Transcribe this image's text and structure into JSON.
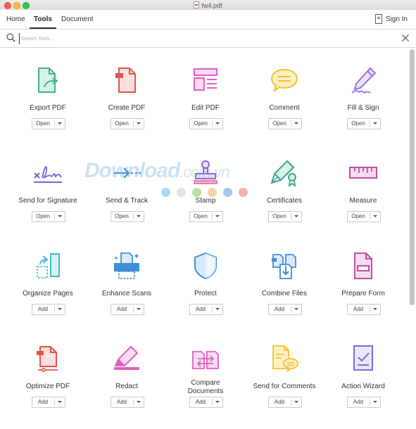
{
  "window": {
    "title": "fw4.pdf"
  },
  "nav": {
    "tabs": [
      {
        "label": "Home"
      },
      {
        "label": "Tools"
      },
      {
        "label": "Document"
      }
    ],
    "signin_label": "Sign In"
  },
  "search": {
    "placeholder": "Search Tools..."
  },
  "watermark": {
    "text": "Download",
    "suffix": ".com.vn",
    "dot_colors": [
      "#a9d8f0",
      "#e3e3e3",
      "#b9dfa4",
      "#f6d4a8",
      "#a3c7ec",
      "#f3b2b2"
    ]
  },
  "tools": [
    {
      "name": "Export PDF",
      "button": "Open",
      "icon": "export-pdf-icon",
      "color": "#3fb48f"
    },
    {
      "name": "Create PDF",
      "button": "Open",
      "icon": "create-pdf-icon",
      "color": "#e2534a"
    },
    {
      "name": "Edit PDF",
      "button": "Open",
      "icon": "edit-pdf-icon",
      "color": "#e060c6"
    },
    {
      "name": "Comment",
      "button": "Open",
      "icon": "comment-icon",
      "color": "#f2c12e"
    },
    {
      "name": "Fill & Sign",
      "button": "Open",
      "icon": "fill-sign-icon",
      "color": "#9b6ee8"
    },
    {
      "name": "Send for Signature",
      "button": "Open",
      "icon": "send-signature-icon",
      "color": "#6f64d8"
    },
    {
      "name": "Send & Track",
      "button": "Open",
      "icon": "send-track-icon",
      "color": "#3a8fd9"
    },
    {
      "name": "Stamp",
      "button": "Open",
      "icon": "stamp-icon",
      "color": "#8b6ad8"
    },
    {
      "name": "Certificates",
      "button": "Open",
      "icon": "certificates-icon",
      "color": "#3fa58a"
    },
    {
      "name": "Measure",
      "button": "Open",
      "icon": "measure-icon",
      "color": "#c14ea3"
    },
    {
      "name": "Organize Pages",
      "button": "Add",
      "icon": "organize-pages-icon",
      "color": "#45b9d6"
    },
    {
      "name": "Enhance Scans",
      "button": "Add",
      "icon": "enhance-scans-icon",
      "color": "#3e8fd5"
    },
    {
      "name": "Protect",
      "button": "Add",
      "icon": "protect-icon",
      "color": "#3a8fd9"
    },
    {
      "name": "Combine Files",
      "button": "Add",
      "icon": "combine-files-icon",
      "color": "#3e8fd5"
    },
    {
      "name": "Prepare Form",
      "button": "Add",
      "icon": "prepare-form-icon",
      "color": "#c14ea3"
    },
    {
      "name": "Optimize PDF",
      "button": "Add",
      "icon": "optimize-pdf-icon",
      "color": "#e2534a"
    },
    {
      "name": "Redact",
      "button": "Add",
      "icon": "redact-icon",
      "color": "#e060c6"
    },
    {
      "name": "Compare Documents",
      "button": "Add",
      "icon": "compare-documents-icon",
      "color": "#e060c6"
    },
    {
      "name": "Send for Comments",
      "button": "Add",
      "icon": "send-comments-icon",
      "color": "#f2c12e"
    },
    {
      "name": "Action Wizard",
      "button": "Add",
      "icon": "action-wizard-icon",
      "color": "#7d6ad8"
    }
  ]
}
